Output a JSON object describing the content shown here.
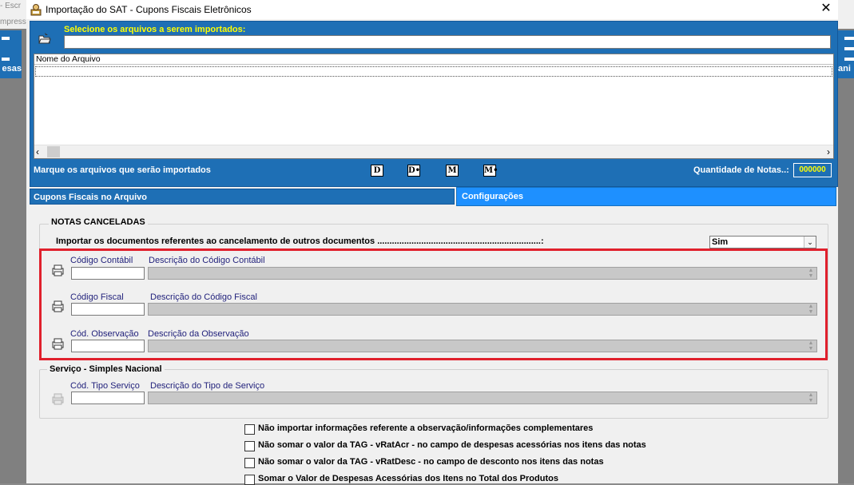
{
  "background": {
    "left_text_1": "- Escr",
    "left_text_2": "mpress",
    "left_button_label": "esas",
    "right_button_label": "ani"
  },
  "window": {
    "title": "Importação do SAT - Cupons Fiscais Eletrônicos",
    "close_glyph": "✕"
  },
  "files_panel": {
    "select_label": "Selecione os arquivos a serem importados:",
    "select_value": "",
    "grid_header": "Nome do Arquivo",
    "mark_label": "Marque os arquivos que serão importados",
    "buttons": [
      "D",
      "D•",
      "M",
      "M•"
    ],
    "quantity_label": "Quantidade de Notas..:",
    "quantity_value": "000000"
  },
  "tabs": [
    {
      "label": "Cupons Fiscais no Arquivo",
      "active": false
    },
    {
      "label": "Configurações",
      "active": true
    }
  ],
  "notas_canceladas": {
    "title": "NOTAS CANCELADAS",
    "import_label": "Importar os documentos referentes ao cancelamento de outros documentos ...................................................................:",
    "import_value": "Sim",
    "fields": [
      {
        "code_label": "Código Contábil",
        "desc_label": "Descrição do Código Contábil",
        "code_value": "",
        "desc_value": ""
      },
      {
        "code_label": "Código Fiscal",
        "desc_label": "Descrição do Código Fiscal",
        "code_value": "",
        "desc_value": ""
      },
      {
        "code_label": "Cód. Observação",
        "desc_label": "Descrição da Observação",
        "code_value": "",
        "desc_value": ""
      }
    ]
  },
  "servico": {
    "title": "Serviço - Simples Nacional",
    "code_label": "Cód. Tipo Serviço",
    "desc_label": "Descrição do Tipo de Serviço"
  },
  "checkboxes": [
    {
      "label": "Não importar informações referente a observação/informações complementares",
      "checked": false
    },
    {
      "label": "Não somar o valor da TAG - vRatAcr - no campo de despesas acessórias nos itens das notas",
      "checked": false
    },
    {
      "label": "Não somar o valor da TAG - vRatDesc - no campo de desconto nos itens das notas",
      "checked": false
    },
    {
      "label": "Somar o Valor de Despesas Acessórias dos Itens no Total dos Produtos",
      "checked": false
    }
  ],
  "colors": {
    "panel_blue": "#1e6fb5",
    "highlight_red": "#e0202c",
    "label_yellow": "#ffff00"
  }
}
